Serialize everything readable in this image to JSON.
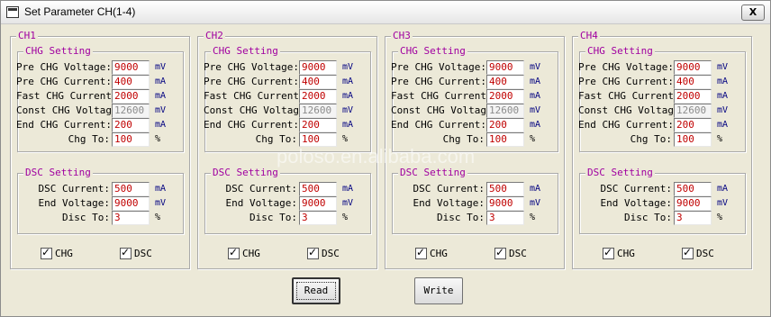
{
  "window": {
    "title": "Set Parameter CH(1-4)",
    "close_glyph": "X"
  },
  "labels": {
    "chg_setting": "CHG Setting",
    "dsc_setting": "DSC Setting",
    "pre_chg_voltage": "Pre CHG Voltage:",
    "pre_chg_current": "Pre CHG Current:",
    "fast_chg_current": "Fast CHG Current:",
    "const_chg_voltage": "Const CHG Voltage",
    "end_chg_current": "End CHG Current:",
    "chg_to": "Chg To:",
    "dsc_current": "DSC Current:",
    "end_voltage": "End Voltage:",
    "disc_to": "Disc To:",
    "chg_check": "CHG",
    "dsc_check": "DSC"
  },
  "units": {
    "mv": "mV",
    "ma": "mA",
    "pct": "%"
  },
  "channels": [
    {
      "name": "CH1",
      "pre_chg_voltage": "9000",
      "pre_chg_current": "400",
      "fast_chg_current": "2000",
      "const_chg_voltage": "12600",
      "end_chg_current": "200",
      "chg_to": "100",
      "dsc_current": "500",
      "end_voltage": "9000",
      "disc_to": "3",
      "chg_checked": true,
      "dsc_checked": true
    },
    {
      "name": "CH2",
      "pre_chg_voltage": "9000",
      "pre_chg_current": "400",
      "fast_chg_current": "2000",
      "const_chg_voltage": "12600",
      "end_chg_current": "200",
      "chg_to": "100",
      "dsc_current": "500",
      "end_voltage": "9000",
      "disc_to": "3",
      "chg_checked": true,
      "dsc_checked": true
    },
    {
      "name": "CH3",
      "pre_chg_voltage": "9000",
      "pre_chg_current": "400",
      "fast_chg_current": "2000",
      "const_chg_voltage": "12600",
      "end_chg_current": "200",
      "chg_to": "100",
      "dsc_current": "500",
      "end_voltage": "9000",
      "disc_to": "3",
      "chg_checked": true,
      "dsc_checked": true
    },
    {
      "name": "CH4",
      "pre_chg_voltage": "9000",
      "pre_chg_current": "400",
      "fast_chg_current": "2000",
      "const_chg_voltage": "12600",
      "end_chg_current": "200",
      "chg_to": "100",
      "dsc_current": "500",
      "end_voltage": "9000",
      "disc_to": "3",
      "chg_checked": true,
      "dsc_checked": true
    }
  ],
  "buttons": {
    "read": "Read",
    "write": "Write"
  },
  "watermark": "poloso.en.alibaba.com"
}
